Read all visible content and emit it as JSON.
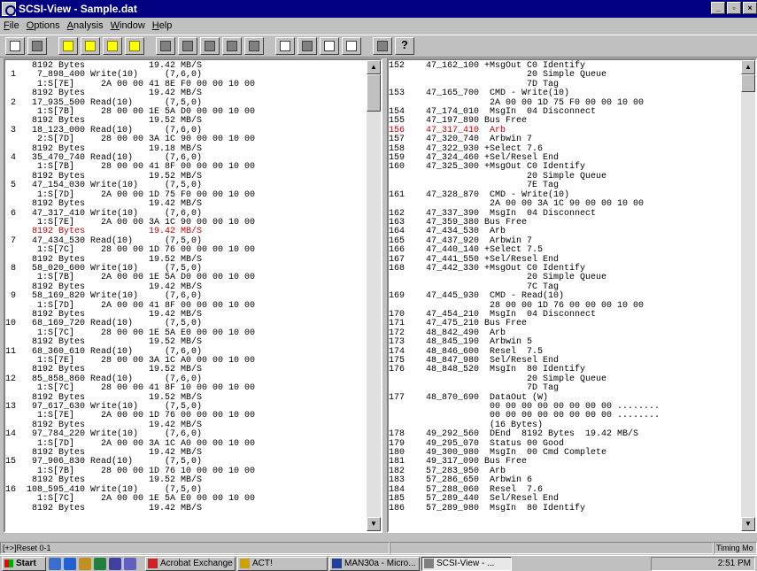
{
  "window": {
    "title": "SCSI-View - Sample.dat"
  },
  "menu": [
    "File",
    "Options",
    "Analysis",
    "Window",
    "Help"
  ],
  "left_rows": [
    "     8192 Bytes            19.42 MB/S",
    " 1    7_898_400 Write(10)     (7,6,0)",
    "      1:S[7E]     2A 00 00 41 8E F0 00 00 10 00",
    "     8192 Bytes            19.42 MB/S",
    " 2   17_935_500 Read(10)      (7,5,0)",
    "      1:S[7B]     28 00 00 1E 5A D0 00 00 10 00",
    "     8192 Bytes            19.52 MB/S",
    " 3   18_123_000 Read(10)      (7,6,0)",
    "      2:S[7D]     28 00 00 3A 1C 90 00 00 10 00",
    "     8192 Bytes            19.18 MB/S",
    " 4   35_470_740 Read(10)      (7,6,0)",
    "      1:S[7B]     28 00 00 41 8F 00 00 00 10 00",
    "     8192 Bytes            19.52 MB/S",
    " 5   47_154_030 Write(10)     (7,5,0)",
    "      1:S[7D]     2A 00 00 1D 75 F0 00 00 10 00",
    "     8192 Bytes            19.42 MB/S",
    " 6   47_317_410 Write(10)     (7,6,0)",
    "      1:S[7E]     2A 00 00 3A 1C 90 00 00 10 00",
    "     8192 Bytes            19.42 MB/S",
    " 7   47_434_530 Read(10)      (7,5,0)",
    "      1:S[7C]     28 00 00 1D 76 00 00 00 10 00",
    "     8192 Bytes            19.52 MB/S",
    " 8   58_020_600 Write(10)     (7,5,0)",
    "      1:S[7B]     2A 00 00 1E 5A D0 00 00 10 00",
    "     8192 Bytes            19.42 MB/S",
    " 9   58_169_820 Write(10)     (7,6,0)",
    "      1:S[7D]     2A 00 00 41 8F 00 00 00 10 00",
    "     8192 Bytes            19.42 MB/S",
    "10   68_169_720 Read(10)      (7,5,0)",
    "      1:S[7C]     28 00 00 1E 5A E0 00 00 10 00",
    "     8192 Bytes            19.52 MB/S",
    "11   68_360_610 Read(10)      (7,6,0)",
    "      1:S[7E]     28 00 00 3A 1C A0 00 00 10 00",
    "     8192 Bytes            19.52 MB/S",
    "12   85_858_860 Read(10)      (7,6,0)",
    "      1:S[7C]     28 00 00 41 8F 10 00 00 10 00",
    "     8192 Bytes            19.52 MB/S",
    "13   97_617_630 Write(10)     (7,5,0)",
    "      1:S[7E]     2A 00 00 1D 76 00 00 00 10 00",
    "     8192 Bytes            19.42 MB/S",
    "14   97_784_220 Write(10)     (7,6,0)",
    "      1:S[7D]     2A 00 00 3A 1C A0 00 00 10 00",
    "     8192 Bytes            19.42 MB/S",
    "15   97_906_830 Read(10)      (7,5,0)",
    "      1:S[7B]     28 00 00 1D 76 10 00 00 10 00",
    "     8192 Bytes            19.52 MB/S",
    "16  108_595_410 Write(10)     (7,5,0)",
    "      1:S[7C]     2A 00 00 1E 5A E0 00 00 10 00",
    "     8192 Bytes            19.42 MB/S"
  ],
  "left_selected_index": 18,
  "right_rows": [
    "152    47_162_100 +MsgOut C0 Identify",
    "                          20 Simple Queue",
    "                          7D Tag",
    "153    47_165_700  CMD - Write(10)",
    "                   2A 00 00 1D 75 F0 00 00 10 00",
    "154    47_174_010  MsgIn  04 Disconnect",
    "155    47_197_890 Bus Free",
    "156    47_317_410  Arb",
    "157    47_320_740  Arbwin 7",
    "158    47_322_930 +Select 7.6",
    "159    47_324_460 +Sel/Resel End",
    "160    47_325_300 +MsgOut C0 Identify",
    "                          20 Simple Queue",
    "                          7E Tag",
    "161    47_328_870  CMD - Write(10)",
    "                   2A 00 00 3A 1C 90 00 00 10 00",
    "162    47_337_390  MsgIn  04 Disconnect",
    "163    47_359_380 Bus Free",
    "164    47_434_530  Arb",
    "165    47_437_920  Arbwin 7",
    "166    47_440_140 +Select 7.5",
    "167    47_441_550 +Sel/Resel End",
    "168    47_442_330 +MsgOut C0 Identify",
    "                          20 Simple Queue",
    "                          7C Tag",
    "169    47_445_930  CMD - Read(10)",
    "                   28 00 00 1D 76 00 00 00 10 00",
    "170    47_454_210  MsgIn  04 Disconnect",
    "171    47_475_210 Bus Free",
    "172    48_842_490  Arb",
    "173    48_845_190  Arbwin 5",
    "174    48_846_600  Resel  7.5",
    "175    48_847_980  Sel/Resel End",
    "176    48_848_520  MsgIn  80 Identify",
    "                          20 Simple Queue",
    "                          7D Tag",
    "177    48_870_690  DataOut (W)",
    "                   00 00 00 00 00 00 00 00 ........",
    "                   00 00 00 00 00 00 00 00 ........",
    "                   (16 Bytes)",
    "178    49_292_560  DEnd  8192 Bytes  19.42 MB/S",
    "179    49_295_070  Status 00 Good",
    "180    49_300_980  MsgIn  00 Cmd Complete",
    "181    49_317_090 Bus Free",
    "182    57_283_950  Arb",
    "183    57_286_650  Arbwin 6",
    "184    57_288_060  Resel  7.6",
    "185    57_289_440  Sel/Resel End",
    "186    57_289_980  MsgIn  80 Identify"
  ],
  "right_selected_index": 7,
  "status": {
    "left": "[+>]Reset 0-1",
    "right": "Timing Mo"
  },
  "taskbar": {
    "start": "Start",
    "tasks": [
      "Acrobat Exchange",
      "ACT!",
      "MAN30a - Micro...",
      "SCSI-View - ..."
    ],
    "clock": "2:51 PM"
  }
}
